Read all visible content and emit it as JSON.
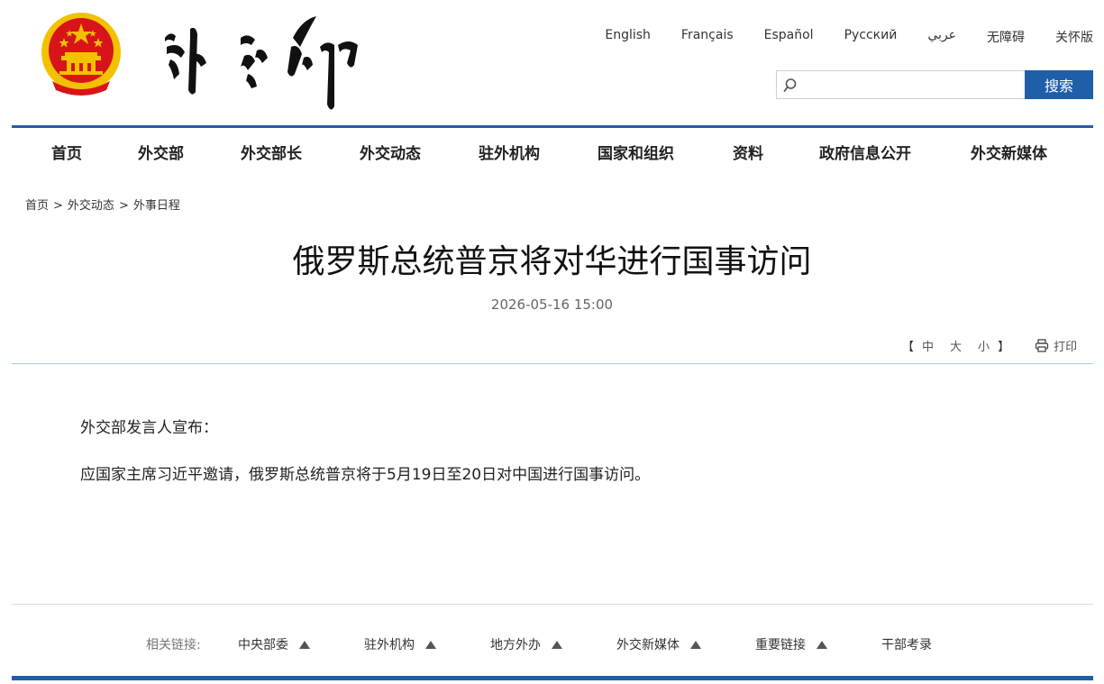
{
  "header": {
    "languages": [
      "English",
      "Français",
      "Español",
      "Русский",
      "عربي",
      "无障碍",
      "关怀版"
    ],
    "search": {
      "button_label": "搜索",
      "value": ""
    }
  },
  "nav": {
    "items": [
      "首页",
      "外交部",
      "外交部长",
      "外交动态",
      "驻外机构",
      "国家和组织",
      "资料",
      "政府信息公开",
      "外交新媒体"
    ]
  },
  "breadcrumb": {
    "items": [
      "首页",
      "外交动态",
      "外事日程"
    ],
    "separator": ">"
  },
  "article": {
    "title": "俄罗斯总统普京将对华进行国事访问",
    "date": "2026-05-16 15:00",
    "font_size": {
      "open": "【",
      "sizes": [
        "中",
        "大",
        "小"
      ],
      "close": "】"
    },
    "print_label": "打印",
    "paragraphs": [
      "外交部发言人宣布：",
      "应国家主席习近平邀请，俄罗斯总统普京将于5月19日至20日对中国进行国事访问。"
    ]
  },
  "footer": {
    "label": "相关链接:",
    "links": [
      "中央部委",
      "驻外机构",
      "地方外办",
      "外交新媒体",
      "重要链接",
      "干部考录"
    ]
  },
  "colors": {
    "accent": "#1f5ea8",
    "emblem_red": "#d7141a",
    "emblem_gold": "#f2c200"
  }
}
